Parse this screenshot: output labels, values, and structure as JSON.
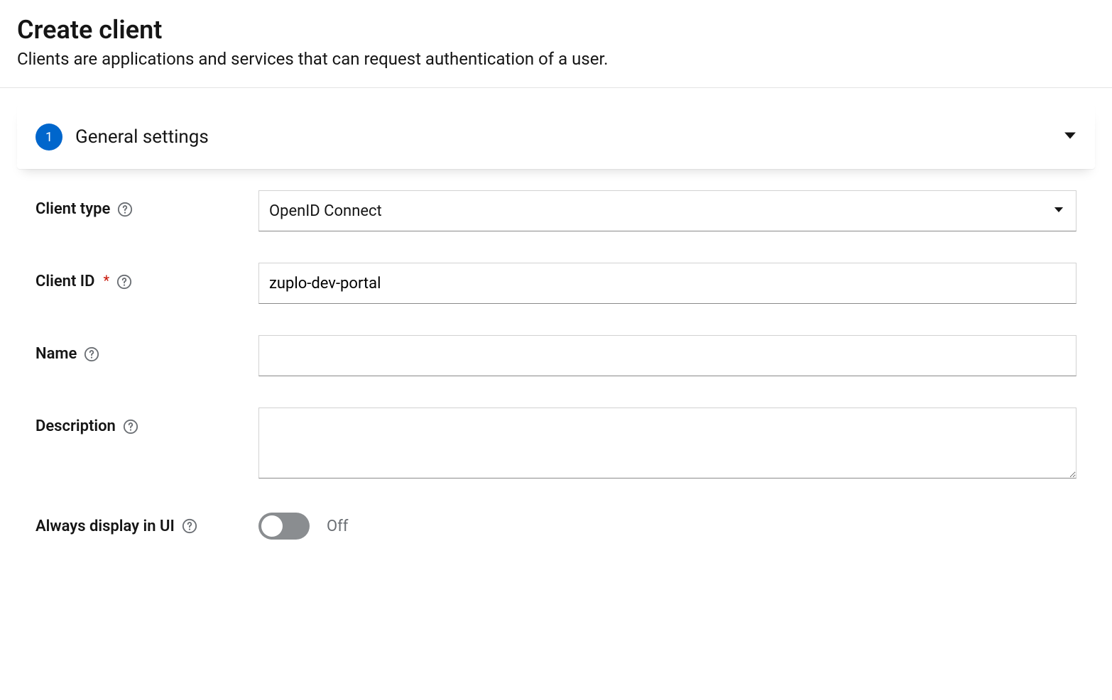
{
  "header": {
    "title": "Create client",
    "subtitle": "Clients are applications and services that can request authentication of a user."
  },
  "wizard": {
    "step_number": "1",
    "step_title": "General settings"
  },
  "form": {
    "client_type": {
      "label": "Client type",
      "value": "OpenID Connect"
    },
    "client_id": {
      "label": "Client ID",
      "value": "zuplo-dev-portal"
    },
    "name": {
      "label": "Name",
      "value": ""
    },
    "description": {
      "label": "Description",
      "value": ""
    },
    "always_display": {
      "label": "Always display in UI",
      "state_label": "Off"
    }
  }
}
